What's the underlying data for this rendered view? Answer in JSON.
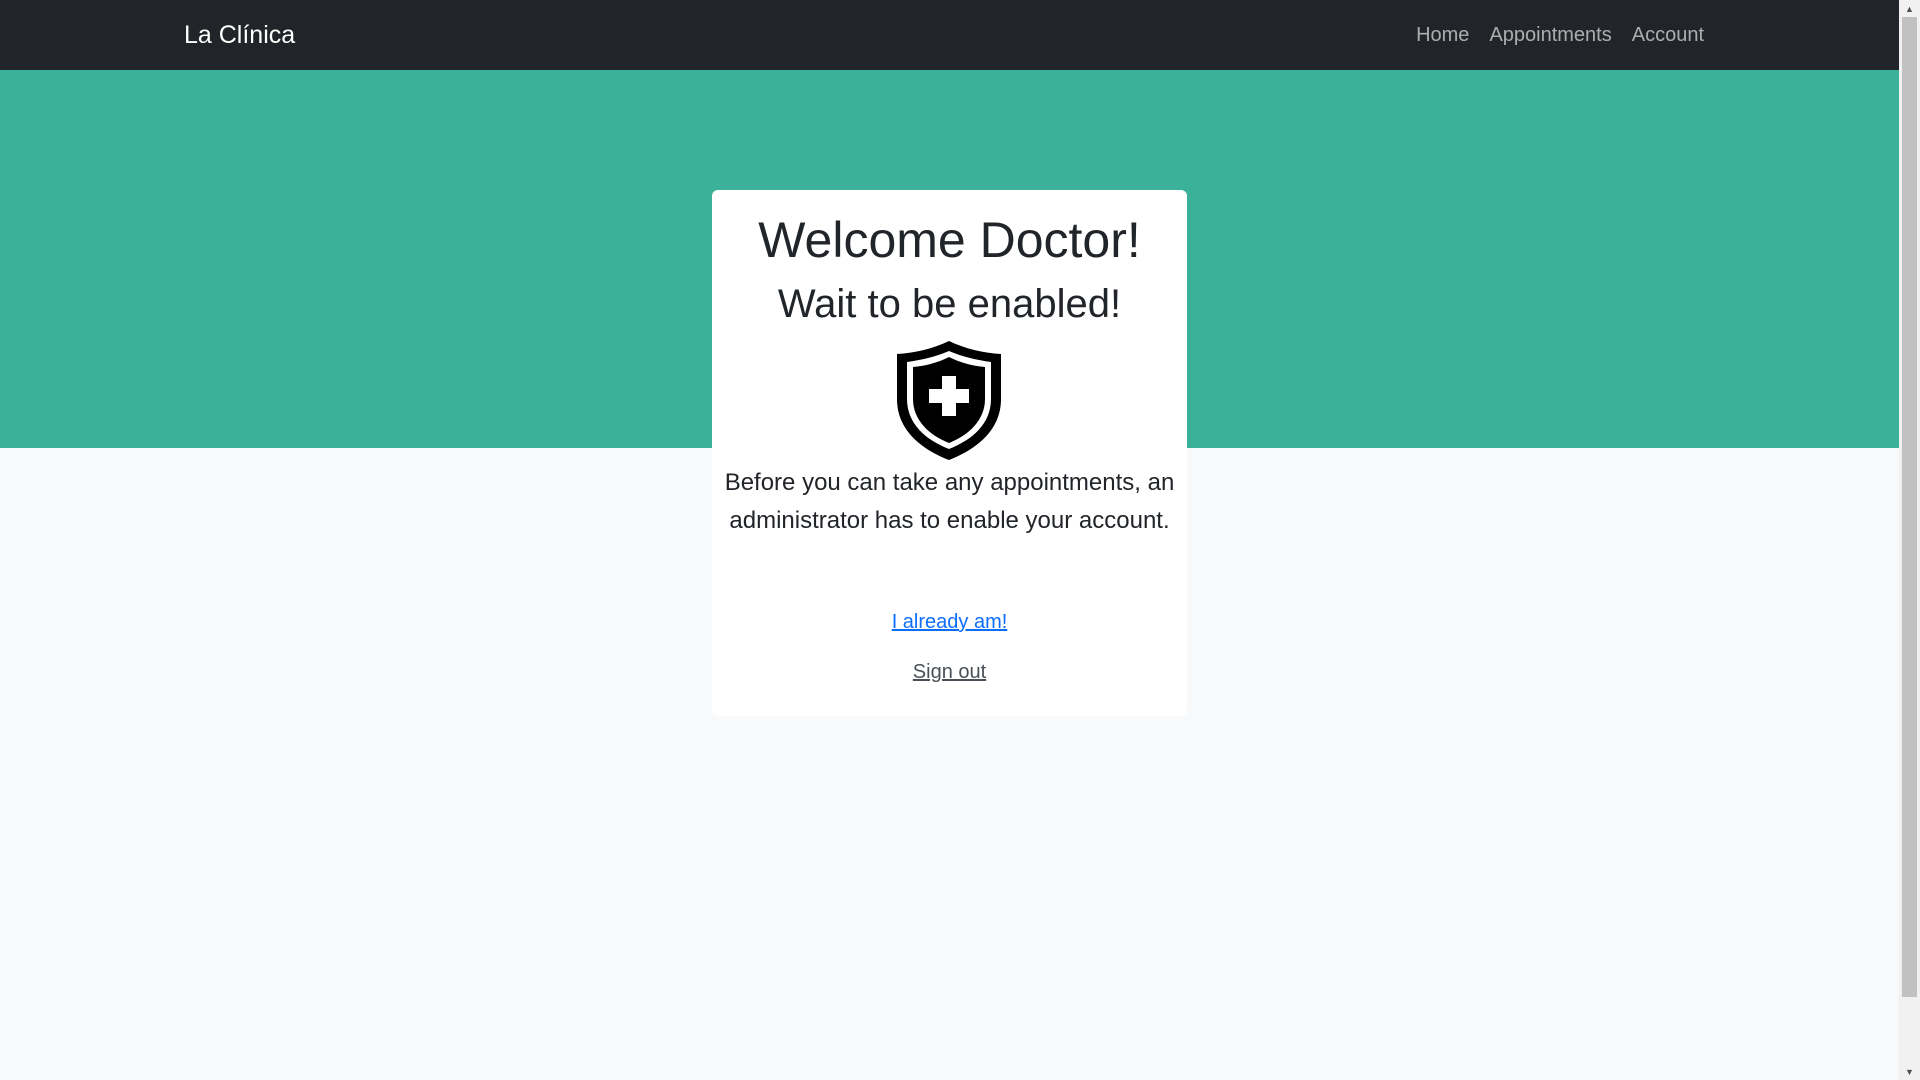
{
  "navbar": {
    "brand": "La Clínica",
    "links": [
      "Home",
      "Appointments",
      "Account"
    ]
  },
  "card": {
    "title": "Welcome Doctor!",
    "subtitle": "Wait to be enabled!",
    "icon": "shield-cross-icon",
    "description": "Before you can take any appointments, an administrator has to enable your account.",
    "primary_link": "I already am!",
    "secondary_link": "Sign out"
  },
  "colors": {
    "navbar": "#212529",
    "hero": "#3cb199",
    "page_background": "#f8f9fa",
    "card_background": "#ffffff",
    "link": "#0d6efd"
  },
  "scrollbar": {
    "up_arrow": "▲",
    "down_arrow": "▼"
  }
}
